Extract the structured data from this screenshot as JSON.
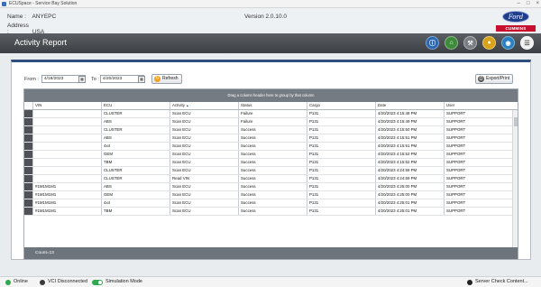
{
  "window": {
    "title": "ECUSpace - Service Bay Solution"
  },
  "info": {
    "name_label": "Name :",
    "name_value": "ANYEPC",
    "address_label": "Address :",
    "address_value": "USA",
    "version": "Version 2.0.10.0"
  },
  "logos": {
    "ford": "Ford",
    "cummins": "CUMMINS"
  },
  "header": {
    "title": "Activity Report",
    "icons": [
      "info-icon",
      "home-icon",
      "wrench-icon",
      "bulb-icon",
      "globe-icon",
      "menu-icon"
    ]
  },
  "filters": {
    "from_label": "From :",
    "from_value": "4/19/2023",
    "to_label": "To :",
    "to_value": "4/20/2023",
    "refresh_label": "Refresh",
    "export_label": "Export/Print"
  },
  "grid": {
    "group_hint": "Drag a column header here to group by that column",
    "columns": [
      "VIN",
      "ECU",
      "Activity",
      "Status",
      "Cargo",
      "Date",
      "User"
    ],
    "rows": [
      [
        "",
        "CLUSTER",
        "Scan ECU",
        "Failure",
        "P131",
        "4/20/2023 4:15:48 PM",
        "SUPPORT"
      ],
      [
        "",
        "ABS",
        "Scan ECU",
        "Failure",
        "P131",
        "4/20/2023 4:15:49 PM",
        "SUPPORT"
      ],
      [
        "",
        "CLUSTER",
        "Scan ECU",
        "Success",
        "P131",
        "4/20/2023 4:15:50 PM",
        "SUPPORT"
      ],
      [
        "",
        "ABS",
        "Scan ECU",
        "Success",
        "P131",
        "4/20/2023 4:15:51 PM",
        "SUPPORT"
      ],
      [
        "",
        "4x4",
        "Scan ECU",
        "Success",
        "P131",
        "4/20/2023 4:15:51 PM",
        "SUPPORT"
      ],
      [
        "",
        "GEM",
        "Scan ECU",
        "Success",
        "P131",
        "4/20/2023 4:15:52 PM",
        "SUPPORT"
      ],
      [
        "",
        "TBM",
        "Scan ECU",
        "Success",
        "P131",
        "4/20/2023 4:15:52 PM",
        "SUPPORT"
      ],
      [
        "",
        "CLUSTER",
        "Scan ECU",
        "Success",
        "P131",
        "4/20/2023 4:24:59 PM",
        "SUPPORT"
      ],
      [
        "",
        "CLUSTER",
        "Read VIN",
        "Success",
        "P131",
        "4/20/2023 4:24:59 PM",
        "SUPPORT"
      ],
      [
        "#1M1M1M1",
        "ABS",
        "Scan ECU",
        "Success",
        "P131",
        "4/20/2023 4:25:00 PM",
        "SUPPORT"
      ],
      [
        "#1M1M1M1",
        "GEM",
        "Scan ECU",
        "Success",
        "P131",
        "4/20/2023 4:25:00 PM",
        "SUPPORT"
      ],
      [
        "#1M1M1M1",
        "4x4",
        "Scan ECU",
        "Success",
        "P131",
        "4/20/2023 4:25:01 PM",
        "SUPPORT"
      ],
      [
        "#1M1M1M1",
        "TBM",
        "Scan ECU",
        "Success",
        "P131",
        "4/20/2023 4:25:01 PM",
        "SUPPORT"
      ]
    ],
    "count_label": "Count=13"
  },
  "status": {
    "online": "Online",
    "vci": "VCI Disconnected",
    "simulation": "Simulation Mode",
    "server": "Server Check Content..."
  },
  "colors": {
    "header_bg": "#4a4d51",
    "panel_border": "#2e4e7c",
    "online": "#2fa84f",
    "vci_disconnected": "#3a3a3a"
  }
}
